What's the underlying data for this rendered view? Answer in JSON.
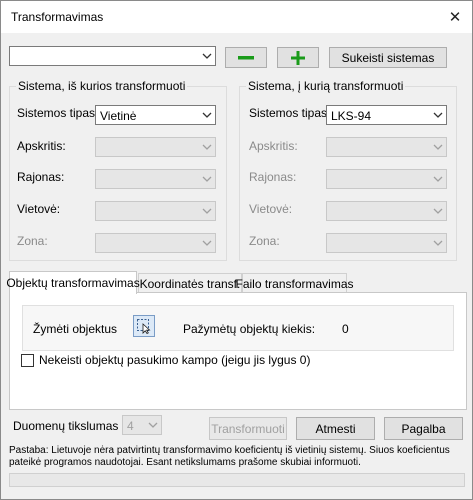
{
  "window": {
    "title": "Transformavimas"
  },
  "top": {
    "system_combo_value": "",
    "minus_label": "−",
    "plus_label": "+",
    "swap_label": "Sukeisti sistemas"
  },
  "source": {
    "group_title": "Sistema, iš kurios transformuoti",
    "type_label": "Sistemos tipas:",
    "type_value": "Vietinė",
    "county_label": "Apskritis:",
    "district_label": "Rajonas:",
    "place_label": "Vietovė:",
    "zone_label": "Zona:"
  },
  "target": {
    "group_title": "Sistema, į kurią transformuoti",
    "type_label": "Sistemos tipas:",
    "type_value": "LKS-94",
    "county_label": "Apskritis:",
    "district_label": "Rajonas:",
    "place_label": "Vietovė:",
    "zone_label": "Zona:"
  },
  "tabs": [
    {
      "label": "Objektų transformavimas"
    },
    {
      "label": "Koordinatės transf."
    },
    {
      "label": "Failo transformavimas"
    }
  ],
  "objects_tab": {
    "mark_label": "Žymėti objektus",
    "marked_count_label": "Pažymėtų objektų kiekis:",
    "marked_count_value": "0",
    "keep_rotation_label": "Nekeisti objektų pasukimo kampo (jeigu jis lygus 0)"
  },
  "bottom": {
    "precision_label": "Duomenų tikslumas",
    "precision_value": "4",
    "transform_label": "Transformuoti",
    "cancel_label": "Atmesti",
    "help_label": "Pagalba"
  },
  "note": "Pastaba: Lietuvoje nėra patvirtintų transformavimo koeficientų iš vietinių sistemų. Siuos koeficientus pateikė programos naudotojai. Esant netikslumams prašome skubiai informuoti.",
  "colors": {
    "plus_green": "#1a9b1a",
    "minus_green": "#1a9b1a",
    "disabled_text": "#a0a0a0"
  },
  "icons": {
    "close": "close-icon",
    "dropdown": "chevron-down-icon",
    "select_objects": "select-objects-icon"
  }
}
